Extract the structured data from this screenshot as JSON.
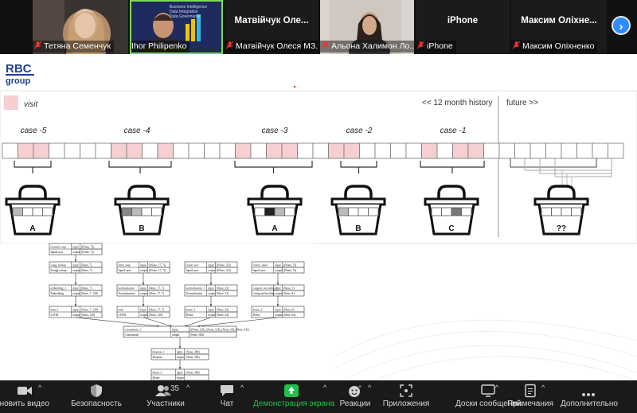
{
  "participants": [
    {
      "name": "Тетяна Семенчук"
    },
    {
      "name": "Ihor Philipenko",
      "slide_lines": [
        "Business Intelligence",
        "Data Integration",
        "Data Governance"
      ]
    },
    {
      "title": "Матвійчук Оле...",
      "name": "Матвійчук Олеся МЗ..."
    },
    {
      "name": "Альона Халимон Ло..."
    },
    {
      "title": "iPhone",
      "name": "iPhone"
    },
    {
      "title": "Максим Оліхне...",
      "name": "Максим Оліхненко"
    }
  ],
  "slide": {
    "logo_top": "RBC",
    "logo_bottom": "group",
    "legend_label": "visit",
    "history_label": "<< 12 month history",
    "future_label": "future >>",
    "cases": [
      "case -5",
      "case -4",
      "case -3",
      "case -2",
      "case -1"
    ],
    "baskets": [
      "A",
      "B",
      "A",
      "B",
      "C",
      "??"
    ],
    "visit_pattern": [
      0,
      1,
      1,
      0,
      0,
      0,
      0,
      1,
      1,
      0,
      1,
      0,
      0,
      0,
      0,
      1,
      0,
      1,
      1,
      0,
      0,
      1,
      1,
      0,
      0,
      0,
      0,
      1,
      0,
      1,
      1,
      0,
      0,
      0,
      0,
      0,
      0,
      0,
      0,
      0
    ],
    "colors": {
      "visit": "#f5cfd2",
      "accent": "#1d3f8f"
    }
  },
  "model_graph": {
    "row1": [
      {
        "name": "scenario_step",
        "type": "InputLayer",
        "in": "[(None, 7)]",
        "out": "[(None, 7)]"
      }
    ],
    "row2": [
      {
        "name": "categ_lookup",
        "type": "StringLookup",
        "in": "(None, 7)",
        "out": "(None, 7)"
      },
      {
        "name": "other_step",
        "type": "InputLayer",
        "in": "[(None, 17, 7)]",
        "out": "[(None, 17, 7)]"
      },
      {
        "name": "cloud_vect",
        "type": "InputLayer",
        "in": "[(None, 32)]",
        "out": "[(None, 32)]"
      },
      {
        "name": "cluster_label",
        "type": "InputLayer",
        "in": "[(None, 5)]",
        "out": "[(None, 5)]"
      }
    ],
    "row3": [
      {
        "name": "embedding_1",
        "type": "Embedding",
        "in": "(None, 7)",
        "out": "(None, 7, 128)"
      },
      {
        "name": "normalization",
        "type": "Normalization",
        "in": "(None, 17, 7)",
        "out": "(None, 17, 7)"
      },
      {
        "name": "normalization_1",
        "type": "Normalization",
        "in": "(None, 32)",
        "out": "(None, 32)"
      },
      {
        "name": "category_encoding_1",
        "type": "CategoryEncoding",
        "in": "(None, 5)",
        "out": "(None, 8)"
      }
    ],
    "row4": [
      {
        "name": "lstm_1",
        "type": "LSTM",
        "in": "(None, 7, 128)",
        "out": "(None, 128)"
      },
      {
        "name": "lstm",
        "type": "LSTM",
        "in": "(None, 17, 7)",
        "out": "(None, 128)"
      },
      {
        "name": "dense_1",
        "type": "Dense",
        "in": "(None, 32)",
        "out": "(None, 64)"
      },
      {
        "name": "dense_2",
        "type": "Dense",
        "in": "(None, 8)",
        "out": "(None, 64)"
      }
    ],
    "concat": {
      "name": "concatenate_1",
      "type": "Concatenate",
      "in": "[(None, 128), (None, 128), (None, 64), (None, 64)]",
      "out": "(None, 384)"
    },
    "dropout": {
      "name": "dropout_1",
      "type": "Dropout",
      "in": "(None, 384)",
      "out": "(None, 384)"
    },
    "dense_out": {
      "name": "dense_3",
      "type": "Dense",
      "in": "(None, 384)",
      "out": ""
    },
    "labels": {
      "input": "input",
      "output": "output"
    }
  },
  "toolbar": {
    "participants_count": "35",
    "items": [
      {
        "label": "ановить видео",
        "icon": "video-camera-icon"
      },
      {
        "label": "Безопасность",
        "icon": "shield-icon"
      },
      {
        "label": "Участники",
        "icon": "participants-icon"
      },
      {
        "label": "Чат",
        "icon": "chat-icon"
      },
      {
        "label": "Демонстрация экрана",
        "icon": "share-screen-icon"
      },
      {
        "label": "Реакции",
        "icon": "reactions-icon"
      },
      {
        "label": "Приложения",
        "icon": "apps-icon"
      },
      {
        "label": "Доски сообщений",
        "icon": "whiteboard-icon"
      },
      {
        "label": "Примечания",
        "icon": "notes-icon"
      },
      {
        "label": "Дополнительно",
        "icon": "more-icon"
      }
    ],
    "share_color": "#21c04a"
  }
}
